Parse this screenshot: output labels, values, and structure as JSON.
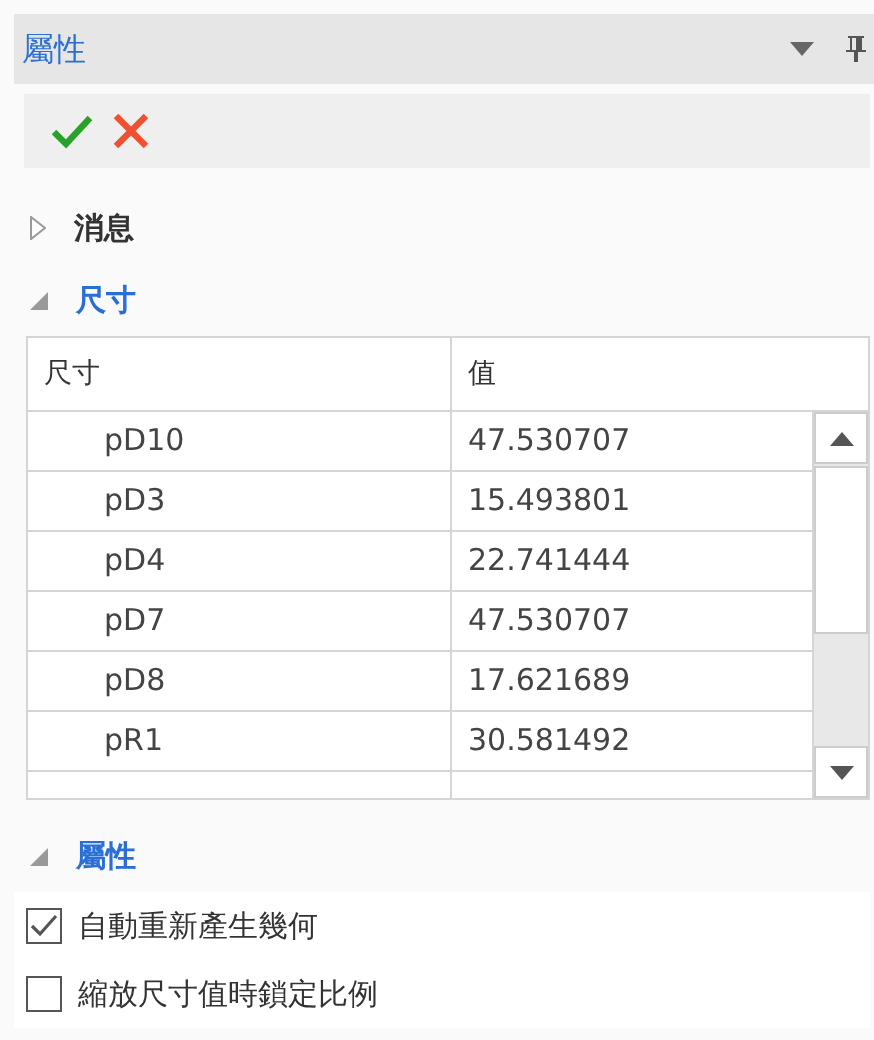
{
  "panel": {
    "title": "屬性"
  },
  "toolbar": {
    "buttons": [
      {
        "kind": "accept"
      },
      {
        "kind": "cancel"
      }
    ]
  },
  "sections": [
    {
      "title": "消息",
      "expanded": false
    },
    {
      "title": "尺寸",
      "expanded": true
    }
  ],
  "table": {
    "columns": [
      "尺寸",
      "值"
    ],
    "rows": [
      {
        "name": "pD10",
        "value": "47.530707"
      },
      {
        "name": "pD3",
        "value": "15.493801"
      },
      {
        "name": "pD4",
        "value": "22.741444"
      },
      {
        "name": "pD7",
        "value": "47.530707"
      },
      {
        "name": "pD8",
        "value": "17.621689"
      },
      {
        "name": "pR1",
        "value": "30.581492"
      }
    ]
  },
  "properties": {
    "title": "屬性",
    "expanded": true,
    "options": [
      {
        "label": "自動重新產生幾何",
        "checked": true
      },
      {
        "label": "縮放尺寸值時鎖定比例",
        "checked": false
      }
    ]
  }
}
